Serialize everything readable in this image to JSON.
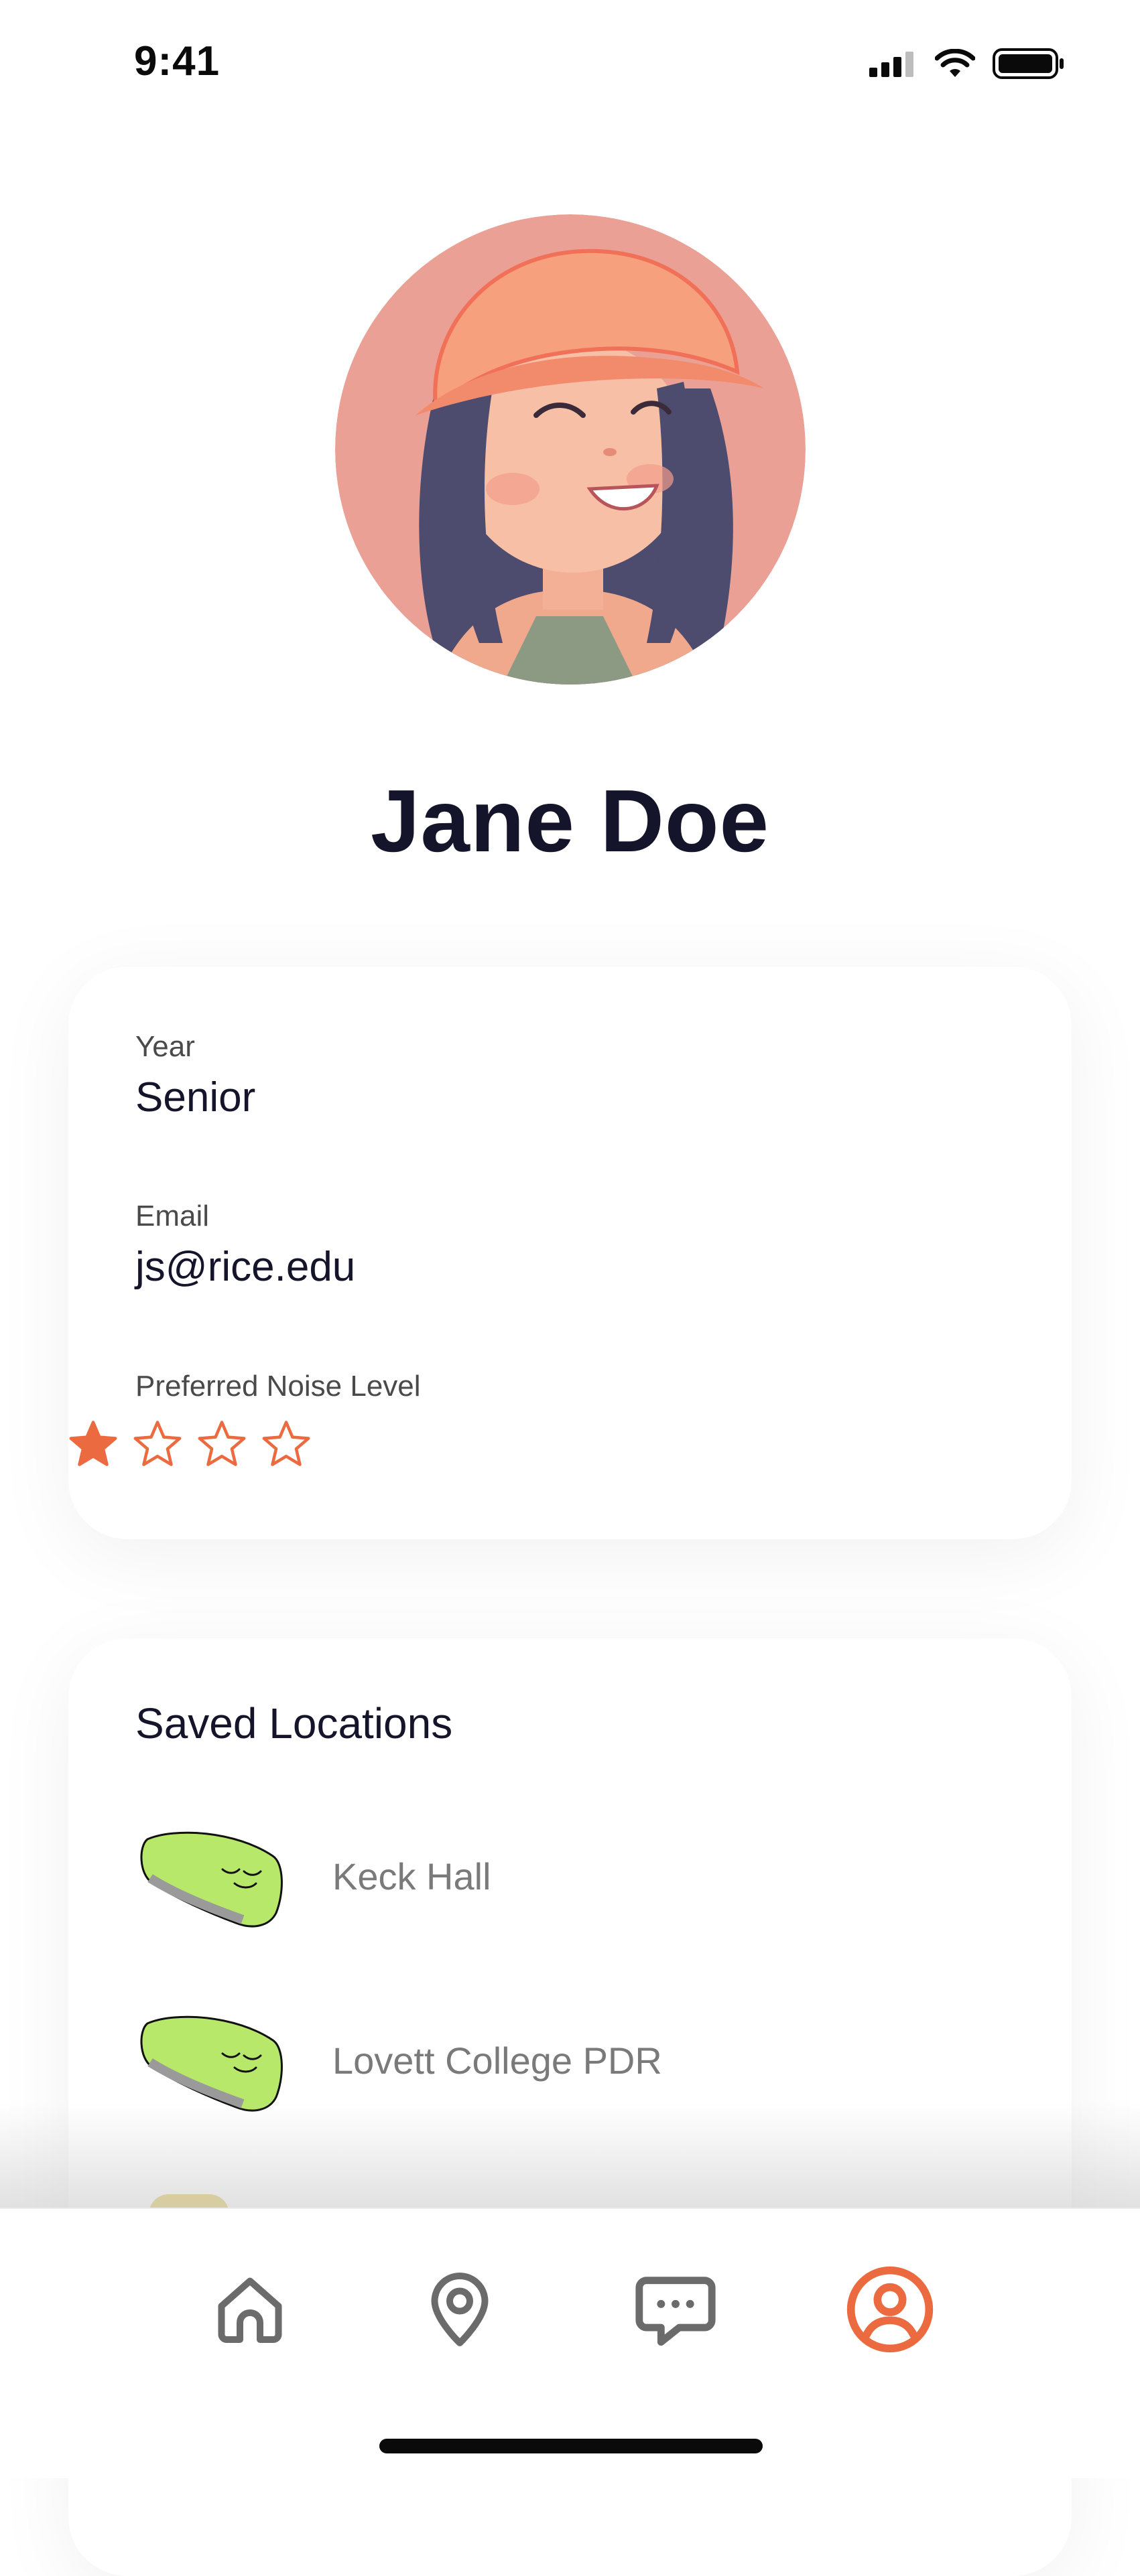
{
  "status_bar": {
    "time": "9:41"
  },
  "profile": {
    "name": "Jane Doe"
  },
  "info": {
    "year_label": "Year",
    "year_value": "Senior",
    "email_label": "Email",
    "email_value": "js@rice.edu",
    "noise_label": "Preferred Noise Level",
    "noise_rating": 1,
    "noise_max": 4
  },
  "saved": {
    "title": "Saved Locations",
    "items": [
      {
        "label": "Keck Hall",
        "icon": "green-pillow-icon"
      },
      {
        "label": "Lovett College PDR",
        "icon": "green-pillow-icon"
      }
    ]
  },
  "tabs": [
    {
      "id": "home",
      "icon": "home-icon"
    },
    {
      "id": "map",
      "icon": "map-pin-icon"
    },
    {
      "id": "messages",
      "icon": "chat-icon"
    },
    {
      "id": "profile",
      "icon": "profile-icon"
    }
  ],
  "colors": {
    "accent": "#EB6A3F",
    "text": "#14142B",
    "muted": "#7A7A7A",
    "pillow": "#B8E86A",
    "tab_inactive": "#6B6B6B"
  }
}
